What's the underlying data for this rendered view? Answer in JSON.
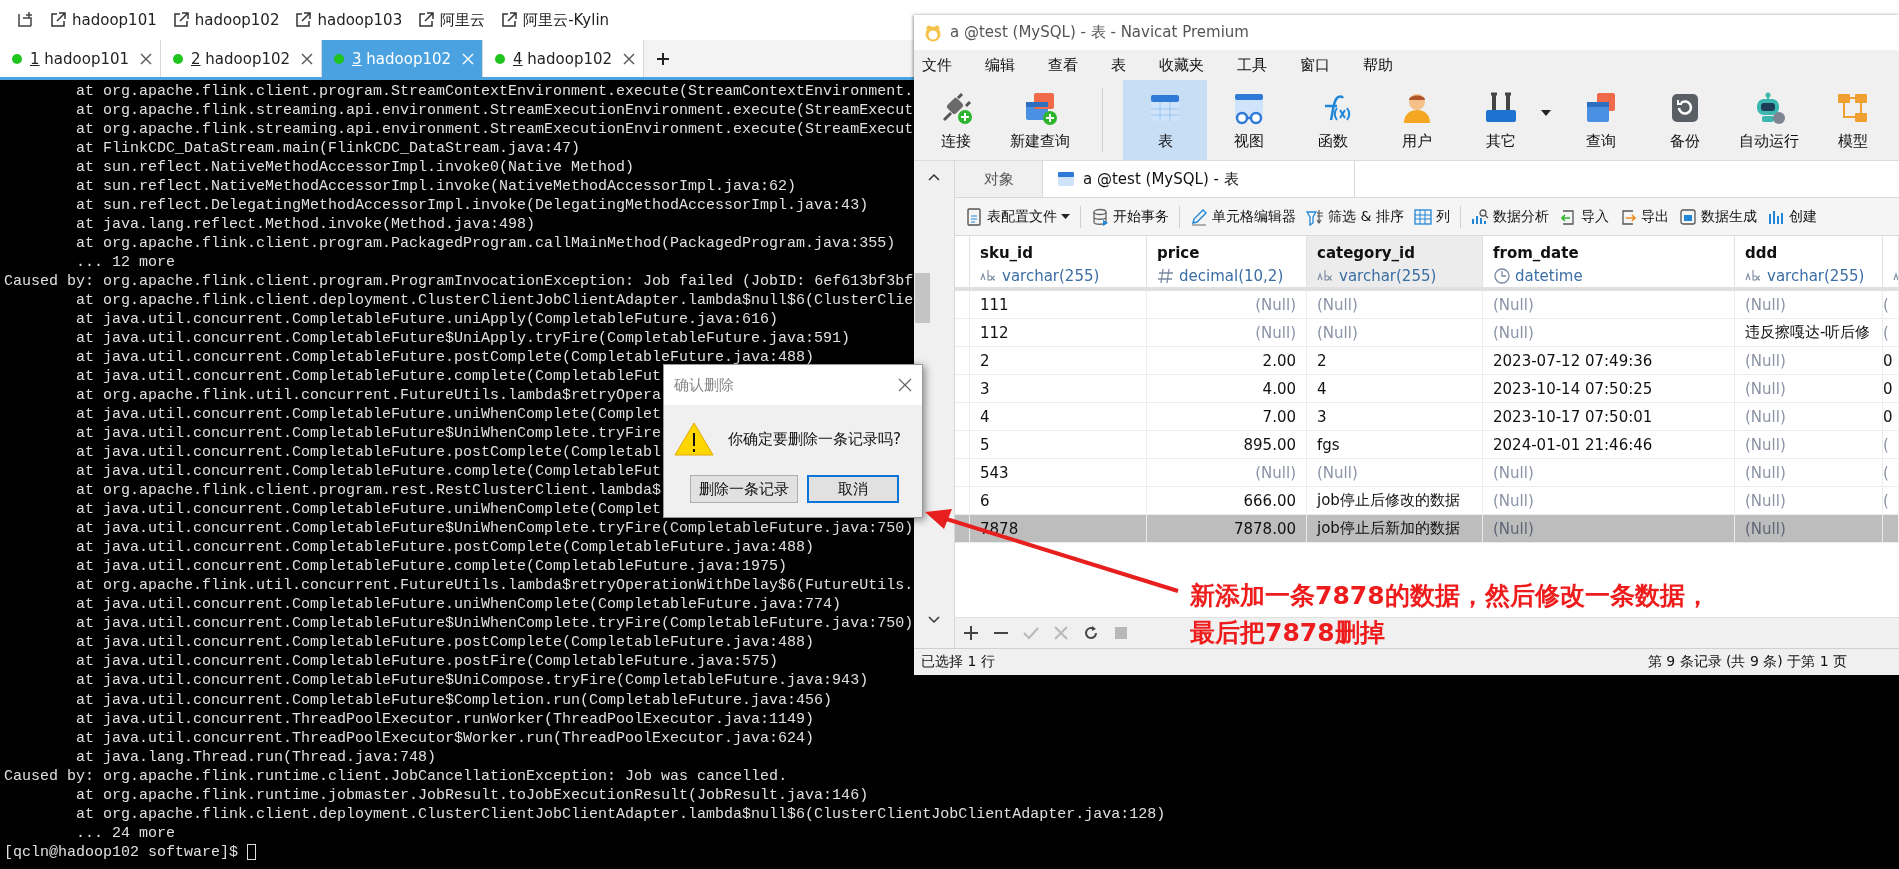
{
  "terminal": {
    "bookmarks": [
      {
        "label": "hadoop101"
      },
      {
        "label": "hadoop102"
      },
      {
        "label": "hadoop103"
      },
      {
        "label": "阿里云"
      },
      {
        "label": "阿里云-Kylin"
      }
    ],
    "tabs": [
      {
        "number": "1",
        "label": "hadoop101",
        "selected": false
      },
      {
        "number": "2",
        "label": "hadoop102",
        "selected": false
      },
      {
        "number": "3",
        "label": "hadoop102",
        "selected": true
      },
      {
        "number": "4",
        "label": "hadoop102",
        "selected": false
      }
    ],
    "lines": [
      {
        "kind": "frame",
        "text": "at org.apache.flink.client.program.StreamContextEnvironment.execute(StreamContextEnvironment."
      },
      {
        "kind": "frame",
        "text": "at org.apache.flink.streaming.api.environment.StreamExecutionEnvironment.execute(StreamExecut"
      },
      {
        "kind": "frame",
        "text": "at org.apache.flink.streaming.api.environment.StreamExecutionEnvironment.execute(StreamExecut"
      },
      {
        "kind": "frame",
        "text": "at FlinkCDC_DataStream.main(FlinkCDC_DataStream.java:47)"
      },
      {
        "kind": "frame",
        "text": "at sun.reflect.NativeMethodAccessorImpl.invoke0(Native Method)"
      },
      {
        "kind": "frame",
        "text": "at sun.reflect.NativeMethodAccessorImpl.invoke(NativeMethodAccessorImpl.java:62)"
      },
      {
        "kind": "frame",
        "text": "at sun.reflect.DelegatingMethodAccessorImpl.invoke(DelegatingMethodAccessorImpl.java:43)"
      },
      {
        "kind": "frame",
        "text": "at java.lang.reflect.Method.invoke(Method.java:498)"
      },
      {
        "kind": "frame",
        "text": "at org.apache.flink.client.program.PackagedProgram.callMainMethod(PackagedProgram.java:355)"
      },
      {
        "kind": "frame",
        "text": "... 12 more"
      },
      {
        "kind": "cause",
        "text": "Caused by: org.apache.flink.client.program.ProgramInvocationException: Job failed (JobID: 6ef613bf3bf"
      },
      {
        "kind": "frame",
        "text": "at org.apache.flink.client.deployment.ClusterClientJobClientAdapter.lambda$null$6(ClusterClie"
      },
      {
        "kind": "frame",
        "text": "at java.util.concurrent.CompletableFuture.uniApply(CompletableFuture.java:616)"
      },
      {
        "kind": "frame",
        "text": "at java.util.concurrent.CompletableFuture$UniApply.tryFire(CompletableFuture.java:591)"
      },
      {
        "kind": "frame",
        "text": "at java.util.concurrent.CompletableFuture.postComplete(CompletableFuture.java:488)"
      },
      {
        "kind": "frame",
        "text": "at java.util.concurrent.CompletableFuture.complete(CompletableFut"
      },
      {
        "kind": "frame",
        "text": "at org.apache.flink.util.concurrent.FutureUtils.lambda$retryOpera"
      },
      {
        "kind": "frame",
        "text": "at java.util.concurrent.CompletableFuture.uniWhenComplete(Complet"
      },
      {
        "kind": "frame",
        "text": "at java.util.concurrent.CompletableFuture$UniWhenComplete.tryFire"
      },
      {
        "kind": "frame",
        "text": "at java.util.concurrent.CompletableFuture.postComplete(Completabl"
      },
      {
        "kind": "frame",
        "text": "at java.util.concurrent.CompletableFuture.complete(CompletableFut"
      },
      {
        "kind": "frame",
        "text": "at org.apache.flink.client.program.rest.RestClusterClient.lambda$"
      },
      {
        "kind": "frame",
        "text": "at java.util.concurrent.CompletableFuture.uniWhenComplete(Complet"
      },
      {
        "kind": "frame",
        "text": "at java.util.concurrent.CompletableFuture$UniWhenComplete.tryFire(CompletableFuture.java:750)"
      },
      {
        "kind": "frame",
        "text": "at java.util.concurrent.CompletableFuture.postComplete(CompletableFuture.java:488)"
      },
      {
        "kind": "frame",
        "text": "at java.util.concurrent.CompletableFuture.complete(CompletableFuture.java:1975)"
      },
      {
        "kind": "frame",
        "text": "at org.apache.flink.util.concurrent.FutureUtils.lambda$retryOperationWithDelay$6(FutureUtils."
      },
      {
        "kind": "frame",
        "text": "at java.util.concurrent.CompletableFuture.uniWhenComplete(CompletableFuture.java:774)"
      },
      {
        "kind": "frame",
        "text": "at java.util.concurrent.CompletableFuture$UniWhenComplete.tryFire(CompletableFuture.java:750)"
      },
      {
        "kind": "frame",
        "text": "at java.util.concurrent.CompletableFuture.postComplete(CompletableFuture.java:488)"
      },
      {
        "kind": "frame",
        "text": "at java.util.concurrent.CompletableFuture.postFire(CompletableFuture.java:575)"
      },
      {
        "kind": "frame",
        "text": "at java.util.concurrent.CompletableFuture$UniCompose.tryFire(CompletableFuture.java:943)"
      },
      {
        "kind": "frame",
        "text": "at java.util.concurrent.CompletableFuture$Completion.run(CompletableFuture.java:456)"
      },
      {
        "kind": "frame",
        "text": "at java.util.concurrent.ThreadPoolExecutor.runWorker(ThreadPoolExecutor.java:1149)"
      },
      {
        "kind": "frame",
        "text": "at java.util.concurrent.ThreadPoolExecutor$Worker.run(ThreadPoolExecutor.java:624)"
      },
      {
        "kind": "frame",
        "text": "at java.lang.Thread.run(Thread.java:748)"
      },
      {
        "kind": "cause",
        "text": "Caused by: org.apache.flink.runtime.client.JobCancellationException: Job was cancelled."
      },
      {
        "kind": "frame",
        "text": "at org.apache.flink.runtime.jobmaster.JobResult.toJobExecutionResult(JobResult.java:146)"
      },
      {
        "kind": "frame",
        "text": "at org.apache.flink.client.deployment.ClusterClientJobClientAdapter.lambda$null$6(ClusterClientJobClientAdapter.java:128)"
      },
      {
        "kind": "frame",
        "text": "... 24 more"
      },
      {
        "kind": "prompt",
        "text": "[qcln@hadoop102 software]$ "
      }
    ]
  },
  "navicat": {
    "title": "a @test (MySQL) - 表 - Navicat Premium",
    "menu": [
      "文件",
      "编辑",
      "查看",
      "表",
      "收藏夹",
      "工具",
      "窗口",
      "帮助"
    ],
    "toolbar": [
      {
        "label": "连接",
        "selected": false,
        "dropdown": false
      },
      {
        "label": "新建查询",
        "selected": false,
        "dropdown": false
      },
      {
        "label": "表",
        "selected": true,
        "dropdown": false
      },
      {
        "label": "视图",
        "selected": false,
        "dropdown": false
      },
      {
        "label": "函数",
        "selected": false,
        "dropdown": false
      },
      {
        "label": "用户",
        "selected": false,
        "dropdown": false
      },
      {
        "label": "其它",
        "selected": false,
        "dropdown": true
      },
      {
        "label": "查询",
        "selected": false,
        "dropdown": false
      },
      {
        "label": "备份",
        "selected": false,
        "dropdown": false
      },
      {
        "label": "自动运行",
        "selected": false,
        "dropdown": false
      },
      {
        "label": "模型",
        "selected": false,
        "dropdown": false
      }
    ],
    "tabs": [
      {
        "label": "对象",
        "selected": false
      },
      {
        "label": "a @test (MySQL) - 表",
        "selected": true
      }
    ],
    "actions": [
      {
        "label": "表配置文件",
        "dropdown": true
      },
      {
        "label": "开始事务",
        "dropdown": false
      },
      {
        "label": "单元格编辑器",
        "dropdown": false
      },
      {
        "label": "筛选 & 排序",
        "dropdown": false
      },
      {
        "label": "列",
        "dropdown": false
      },
      {
        "label": "数据分析",
        "dropdown": false
      },
      {
        "label": "导入",
        "dropdown": false
      },
      {
        "label": "导出",
        "dropdown": false
      },
      {
        "label": "数据生成",
        "dropdown": false
      },
      {
        "label": "创建",
        "dropdown": false
      }
    ],
    "table": {
      "columns": [
        {
          "name": "sku_id",
          "type": "varchar(255)",
          "kind": "text",
          "selected": false
        },
        {
          "name": "price",
          "type": "decimal(10,2)",
          "kind": "number",
          "selected": false
        },
        {
          "name": "category_id",
          "type": "varchar(255)",
          "kind": "text",
          "selected": true
        },
        {
          "name": "from_date",
          "type": "datetime",
          "kind": "datetime",
          "selected": false
        },
        {
          "name": "ddd",
          "type": "varchar(255)",
          "kind": "text",
          "selected": false
        },
        {
          "kind": "text",
          "selected": false
        }
      ],
      "rows": [
        {
          "selected": false,
          "cells": [
            {
              "text": "111",
              "is_null": false
            },
            {
              "text": "(Null)",
              "is_null": true
            },
            {
              "text": "(Null)",
              "is_null": true
            },
            {
              "text": "(Null)",
              "is_null": true
            },
            {
              "text": "(Null)",
              "is_null": true
            },
            {
              "text": "(",
              "is_null": true
            }
          ]
        },
        {
          "selected": false,
          "cells": [
            {
              "text": "112",
              "is_null": false
            },
            {
              "text": "(Null)",
              "is_null": true
            },
            {
              "text": "(Null)",
              "is_null": true
            },
            {
              "text": "(Null)",
              "is_null": true
            },
            {
              "text": "违反擦嘎达-听后修",
              "is_null": false
            },
            {
              "text": "(",
              "is_null": true
            }
          ]
        },
        {
          "selected": false,
          "cells": [
            {
              "text": "2",
              "is_null": false
            },
            {
              "text": "2.00",
              "is_null": false
            },
            {
              "text": "2",
              "is_null": false
            },
            {
              "text": "2023-07-12 07:49:36",
              "is_null": false
            },
            {
              "text": "(Null)",
              "is_null": true
            },
            {
              "text": "0",
              "is_null": false
            }
          ]
        },
        {
          "selected": false,
          "cells": [
            {
              "text": "3",
              "is_null": false
            },
            {
              "text": "4.00",
              "is_null": false
            },
            {
              "text": "4",
              "is_null": false
            },
            {
              "text": "2023-10-14 07:50:25",
              "is_null": false
            },
            {
              "text": "(Null)",
              "is_null": true
            },
            {
              "text": "0",
              "is_null": false
            }
          ]
        },
        {
          "selected": false,
          "cells": [
            {
              "text": "4",
              "is_null": false
            },
            {
              "text": "7.00",
              "is_null": false
            },
            {
              "text": "3",
              "is_null": false
            },
            {
              "text": "2023-10-17 07:50:01",
              "is_null": false
            },
            {
              "text": "(Null)",
              "is_null": true
            },
            {
              "text": "0",
              "is_null": false
            }
          ]
        },
        {
          "selected": false,
          "cells": [
            {
              "text": "5",
              "is_null": false
            },
            {
              "text": "895.00",
              "is_null": false
            },
            {
              "text": "fgs",
              "is_null": false
            },
            {
              "text": "2024-01-01 21:46:46",
              "is_null": false
            },
            {
              "text": "(Null)",
              "is_null": true
            },
            {
              "text": "(",
              "is_null": true
            }
          ]
        },
        {
          "selected": false,
          "cells": [
            {
              "text": "543",
              "is_null": false
            },
            {
              "text": "(Null)",
              "is_null": true
            },
            {
              "text": "(Null)",
              "is_null": true
            },
            {
              "text": "(Null)",
              "is_null": true
            },
            {
              "text": "(Null)",
              "is_null": true
            },
            {
              "text": "(",
              "is_null": true
            }
          ]
        },
        {
          "selected": false,
          "cells": [
            {
              "text": "6",
              "is_null": false
            },
            {
              "text": "666.00",
              "is_null": false
            },
            {
              "text": "job停止后修改的数据",
              "is_null": false
            },
            {
              "text": "(Null)",
              "is_null": true
            },
            {
              "text": "(Null)",
              "is_null": true
            },
            {
              "text": "(",
              "is_null": true
            }
          ]
        },
        {
          "selected": true,
          "cells": [
            {
              "text": "7878",
              "is_null": false
            },
            {
              "text": "7878.00",
              "is_null": false
            },
            {
              "text": "job停止后新加的数据",
              "is_null": false
            },
            {
              "text": "(Null)",
              "is_null": true
            },
            {
              "text": "(Null)",
              "is_null": true
            }
          ]
        }
      ]
    },
    "record_buttons": [
      {
        "disabled": false
      },
      {
        "disabled": false
      },
      {
        "disabled": true
      },
      {
        "disabled": true
      },
      {
        "disabled": false
      },
      {
        "disabled": true
      }
    ],
    "status_bar": {
      "selection": "已选择 1 行",
      "position": "第 9 条记录 (共 9 条) 于第 1 页"
    }
  },
  "dialog": {
    "title": "确认删除",
    "message": "你确定要删除一条记录吗?",
    "buttons": [
      {
        "label": "删除一条记录",
        "focused": false
      },
      {
        "label": "取消",
        "focused": true
      }
    ]
  },
  "annotation": {
    "lines": [
      "新添加一条7878的数据，然后修改一条数据，",
      "最后把7878删掉"
    ]
  }
}
